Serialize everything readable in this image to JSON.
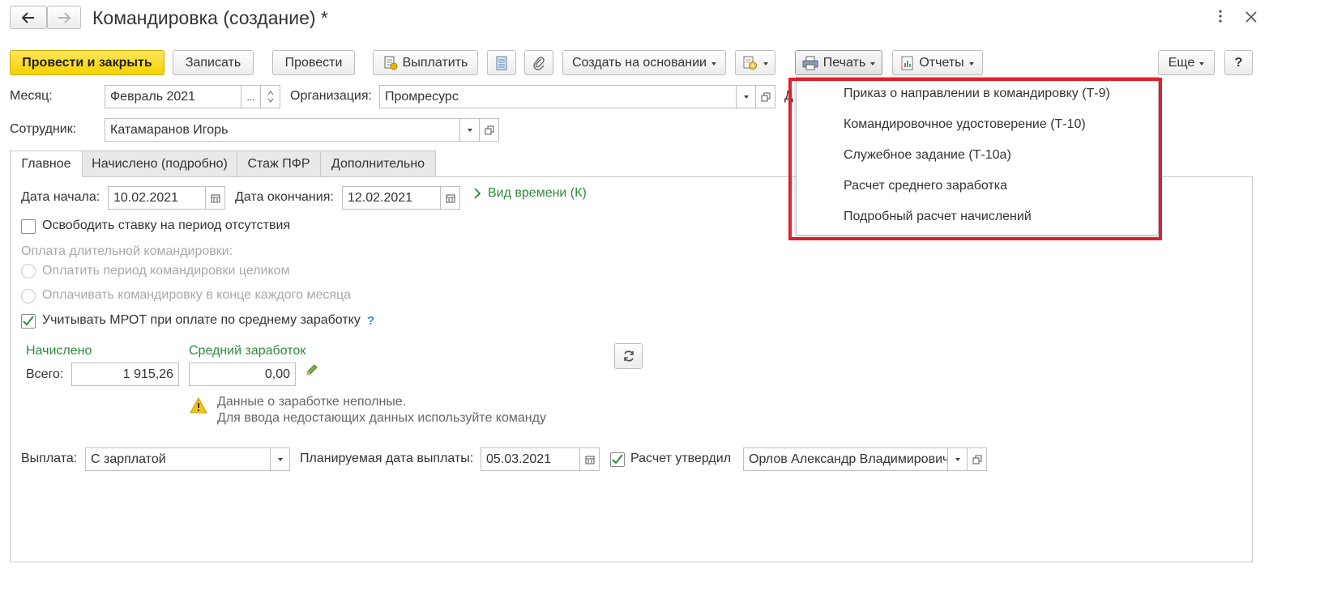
{
  "window": {
    "title": "Командировка (создание) *"
  },
  "toolbar": {
    "post_close": "Провести и закрыть",
    "save": "Записать",
    "post": "Провести",
    "pay": "Выплатить",
    "create_based_on": "Создать на основании",
    "print": "Печать",
    "reports": "Отчеты",
    "more": "Еще",
    "help": "?"
  },
  "header": {
    "month_label": "Месяц:",
    "month_value": "Февраль 2021",
    "org_label": "Организация:",
    "org_value": "Промресурс",
    "employee_label": "Сотрудник:",
    "employee_value": "Катамаранов Игорь",
    "cut_label": "Д"
  },
  "tabs": [
    {
      "label": "Главное"
    },
    {
      "label": "Начислено (подробно)"
    },
    {
      "label": "Стаж ПФР"
    },
    {
      "label": "Дополнительно"
    }
  ],
  "main": {
    "start_label": "Дата начала:",
    "start_value": "10.02.2021",
    "end_label": "Дата окончания:",
    "end_value": "12.02.2021",
    "time_type_link": "Вид времени (К)",
    "free_rate": "Освободить ставку на период отсутствия",
    "long_trip_label": "Оплата длительной командировки:",
    "radio_whole": "Оплатить период командировки целиком",
    "radio_monthly": "Оплачивать командировку в конце каждого месяца",
    "mrot": "Учитывать МРОТ при оплате по среднему заработку",
    "mrot_help": "?",
    "accrued_label": "Начислено",
    "total_label": "Всего:",
    "total_value": "1 915,26",
    "avg_label": "Средний заработок",
    "avg_value": "0,00",
    "warning_line1": "Данные о заработке неполные.",
    "warning_line2": "Для ввода недостающих данных используйте команду",
    "payout_label": "Выплата:",
    "payout_value": "С зарплатой",
    "planned_date_label": "Планируемая дата выплаты:",
    "planned_date_value": "05.03.2021",
    "approved_label": "Расчет утвердил",
    "approved_value": "Орлов Александр Владимирович"
  },
  "print_menu": {
    "items": [
      "Приказ о направлении в командировку (Т-9)",
      "Командировочное удостоверение (Т-10)",
      "Служебное задание (Т-10а)",
      "Расчет среднего заработка",
      "Подробный расчет начислений"
    ],
    "highlight_color": "#e0202a"
  },
  "colors": {
    "primary_button": "#f5d300",
    "link_green": "#2e8b3e",
    "warning_yellow": "#f0c419"
  },
  "icons": [
    "back-arrow-icon",
    "forward-arrow-icon",
    "kebab-icon",
    "close-icon",
    "pay-icon",
    "document-list-icon",
    "paperclip-icon",
    "document-gear-icon",
    "printer-icon",
    "report-icon",
    "calendar-icon",
    "chevron-right-icon",
    "pencil-icon",
    "refresh-icon",
    "warning-icon"
  ]
}
